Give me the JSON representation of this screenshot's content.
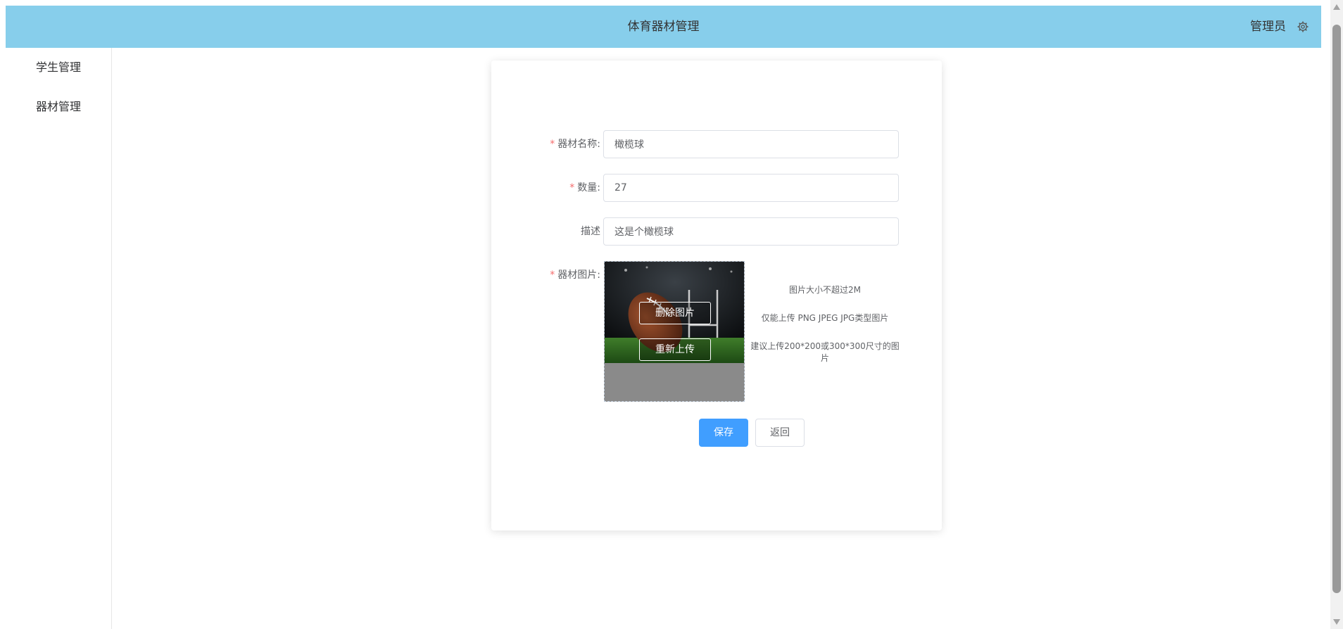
{
  "header": {
    "title": "体育器材管理",
    "user": "管理员",
    "settings_icon": "gear-icon",
    "background_color": "#87ceeb"
  },
  "sidebar": {
    "items": [
      {
        "label": "学生管理"
      },
      {
        "label": "器材管理"
      }
    ]
  },
  "form": {
    "name": {
      "label": "器材名称:",
      "required": true,
      "value": "橄榄球"
    },
    "quantity": {
      "label": "数量:",
      "required": true,
      "value": "27"
    },
    "description": {
      "label": "描述",
      "required": false,
      "value": "这是个橄榄球"
    },
    "image": {
      "label": "器材图片:",
      "required": true,
      "delete_label": "删除图片",
      "reupload_label": "重新上传",
      "hints": [
        "图片大小不超过2M",
        "仅能上传 PNG JPEG JPG类型图片",
        "建议上传200*200或300*300尺寸的图片"
      ]
    },
    "save_label": "保存",
    "back_label": "返回"
  },
  "colors": {
    "primary": "#409eff",
    "required": "#f56c6c"
  }
}
